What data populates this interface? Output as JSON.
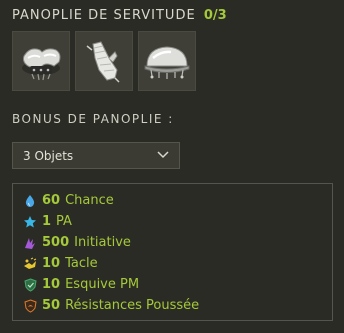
{
  "set": {
    "title": "PANOPLIE DE SERVITUDE",
    "count": "0/3",
    "items": [
      {
        "icon": "shoulder-armor-icon"
      },
      {
        "icon": "glove-icon"
      },
      {
        "icon": "helmet-icon"
      }
    ]
  },
  "bonus": {
    "title": "BONUS DE PANOPLIE :",
    "selected_option": "3 Objets",
    "stats": [
      {
        "value": "60",
        "label": "Chance",
        "icon": "water-drop-icon",
        "color": "#4aa8e8"
      },
      {
        "value": "1",
        "label": "PA",
        "icon": "star-icon",
        "color": "#38b6e6"
      },
      {
        "value": "500",
        "label": "Initiative",
        "icon": "initiative-icon",
        "color": "#a45ad8"
      },
      {
        "value": "10",
        "label": "Tacle",
        "icon": "tackle-icon",
        "color": "#e6c631"
      },
      {
        "value": "10",
        "label": "Esquive PM",
        "icon": "dodge-shield-icon",
        "color": "#47a86a"
      },
      {
        "value": "50",
        "label": "Résistances Poussée",
        "icon": "push-resistance-icon",
        "color": "#e07a2a"
      }
    ]
  },
  "colors": {
    "accent": "#a4c93a",
    "background": "#2b2b25",
    "border": "#55554b"
  }
}
